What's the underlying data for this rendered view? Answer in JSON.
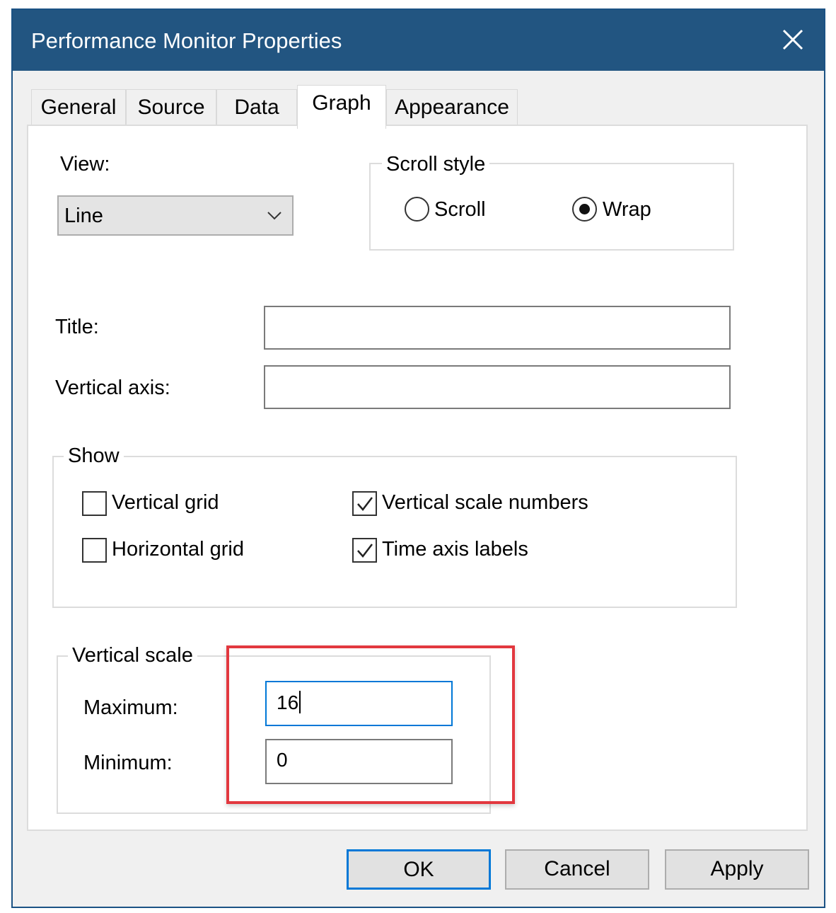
{
  "window": {
    "title": "Performance Monitor Properties",
    "close_icon": "close-icon"
  },
  "tabs": [
    {
      "label": "General",
      "active": false
    },
    {
      "label": "Source",
      "active": false
    },
    {
      "label": "Data",
      "active": false
    },
    {
      "label": "Graph",
      "active": true
    },
    {
      "label": "Appearance",
      "active": false
    }
  ],
  "view": {
    "label": "View:",
    "selected": "Line"
  },
  "scroll_style": {
    "legend": "Scroll style",
    "options": [
      {
        "label": "Scroll",
        "selected": false
      },
      {
        "label": "Wrap",
        "selected": true
      }
    ]
  },
  "title_field": {
    "label": "Title:",
    "value": ""
  },
  "vertical_axis_field": {
    "label": "Vertical axis:",
    "value": ""
  },
  "show": {
    "legend": "Show",
    "items": [
      {
        "label": "Vertical grid",
        "checked": false
      },
      {
        "label": "Horizontal grid",
        "checked": false
      },
      {
        "label": "Vertical scale numbers",
        "checked": true
      },
      {
        "label": "Time axis labels",
        "checked": true
      }
    ]
  },
  "vertical_scale": {
    "legend": "Vertical scale",
    "maximum_label": "Maximum:",
    "maximum_value": "16",
    "minimum_label": "Minimum:",
    "minimum_value": "0"
  },
  "buttons": {
    "ok": "OK",
    "cancel": "Cancel",
    "apply": "Apply"
  },
  "colors": {
    "titlebar": "#225581",
    "highlight": "#e2383f",
    "focus": "#0078d7"
  }
}
